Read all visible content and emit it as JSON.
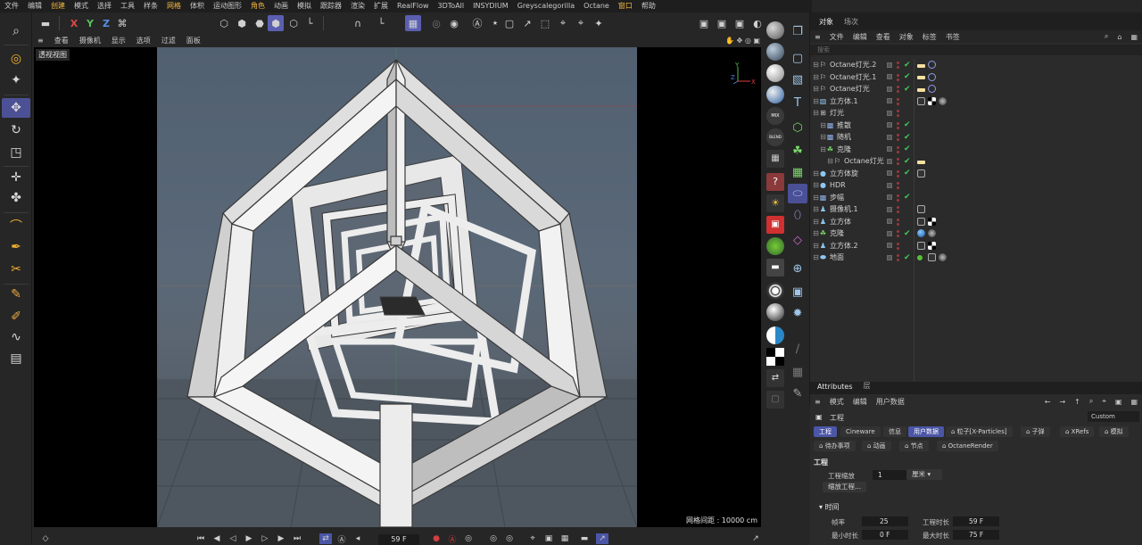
{
  "menubar": {
    "items": [
      {
        "label": "文件"
      },
      {
        "label": "编辑"
      },
      {
        "label": "创建",
        "highlight": true
      },
      {
        "label": "模式"
      },
      {
        "label": "选择"
      },
      {
        "label": "工具"
      },
      {
        "label": "样条"
      },
      {
        "label": "网格",
        "highlight": true
      },
      {
        "label": "体积"
      },
      {
        "label": "运动图形"
      },
      {
        "label": "角色",
        "highlight": true
      },
      {
        "label": "动画"
      },
      {
        "label": "模拟"
      },
      {
        "label": "跟踪器"
      },
      {
        "label": "渲染"
      },
      {
        "label": "扩展"
      },
      {
        "label": "RealFlow"
      },
      {
        "label": "3DToAll"
      },
      {
        "label": "INSYDIUM"
      },
      {
        "label": "Greyscalegorilla"
      },
      {
        "label": "Octane"
      },
      {
        "label": "窗口",
        "highlight": true
      },
      {
        "label": "帮助"
      }
    ]
  },
  "toolbar": {
    "axis_x": "X",
    "axis_y": "Y",
    "axis_z": "Z"
  },
  "viewmenu": {
    "items": [
      "查看",
      "摄像机",
      "显示",
      "选项",
      "过滤",
      "面板"
    ]
  },
  "viewport": {
    "label": "透视视图",
    "grid_spacing": "网格间距 : 10000 cm",
    "axis_x": "X",
    "axis_y": "Y",
    "axis_z": "Z"
  },
  "timeline": {
    "frame": "59 F"
  },
  "objects": {
    "tabs": [
      "对象",
      "场次"
    ],
    "menu": [
      "文件",
      "编辑",
      "查看",
      "对象",
      "标签",
      "书签"
    ],
    "search_placeholder": "搜索",
    "rows": [
      {
        "name": "Octane灯光.2",
        "indent": 0,
        "icon": "light-icon",
        "check": true,
        "tags": [
          "light-tag",
          "target-tag"
        ]
      },
      {
        "name": "Octane灯光.1",
        "indent": 0,
        "icon": "light-icon",
        "check": true,
        "tags": [
          "light-tag",
          "target-tag"
        ]
      },
      {
        "name": "Octane灯光",
        "indent": 0,
        "icon": "light-icon",
        "check": true,
        "tags": [
          "light-tag",
          "target-tag"
        ]
      },
      {
        "name": "立方体.1",
        "indent": 0,
        "icon": "cube-icon",
        "check": false,
        "tags": [
          "phong-tag",
          "texture-tag",
          "material-tag"
        ]
      },
      {
        "name": "灯光",
        "indent": 0,
        "icon": "null-icon",
        "check": false,
        "tags": []
      },
      {
        "name": "推散",
        "indent": 1,
        "icon": "effector-icon",
        "check": true,
        "tags": []
      },
      {
        "name": "随机",
        "indent": 1,
        "icon": "effector-icon",
        "check": true,
        "tags": []
      },
      {
        "name": "克隆",
        "indent": 1,
        "icon": "cloner-icon",
        "check": true,
        "tags": []
      },
      {
        "name": "Octane灯光",
        "indent": 2,
        "icon": "light-icon",
        "check": true,
        "tags": [
          "light-tag"
        ]
      },
      {
        "name": "立方体旋",
        "indent": 0,
        "icon": "sphere-icon",
        "check": true,
        "tags": [
          "phong-tag"
        ]
      },
      {
        "name": "HDR",
        "indent": 0,
        "icon": "sphere-icon",
        "check": false,
        "tags": []
      },
      {
        "name": "步幅",
        "indent": 0,
        "icon": "effector-icon",
        "check": true,
        "tags": []
      },
      {
        "name": "摄像机.1",
        "indent": 0,
        "icon": "camera-icon",
        "check": false,
        "tags": [
          "phong-tag"
        ]
      },
      {
        "name": "立方体",
        "indent": 0,
        "icon": "camera-icon",
        "check": false,
        "tags": [
          "phong-tag",
          "texture-tag"
        ]
      },
      {
        "name": "克隆",
        "indent": 0,
        "icon": "cloner-icon",
        "check": true,
        "tags": [
          "blue-sphere-tag",
          "material-tag"
        ]
      },
      {
        "name": "立方体.2",
        "indent": 0,
        "icon": "camera-icon",
        "check": false,
        "tags": [
          "phong-tag",
          "texture-tag"
        ]
      },
      {
        "name": "地面",
        "indent": 0,
        "icon": "floor-icon",
        "check": true,
        "tags": [
          "green-dot-tag",
          "phong-tag",
          "material-tag"
        ]
      }
    ]
  },
  "attributes": {
    "tabs": [
      "Attributes",
      "层"
    ],
    "menu": [
      "模式",
      "编辑",
      "用户数据"
    ],
    "title": "工程",
    "mode": "Custom",
    "tabs_row1": [
      {
        "label": "工程",
        "active": true
      },
      {
        "label": "Cineware"
      },
      {
        "label": "信息"
      },
      {
        "label": "用户数据",
        "active": true
      },
      {
        "label": "粒子[X-Particles]"
      },
      {
        "label": "子弹"
      },
      {
        "label": "XRefs"
      },
      {
        "label": "模拟"
      }
    ],
    "tabs_row2": [
      {
        "label": "待办事项"
      },
      {
        "label": "动画"
      },
      {
        "label": "节点"
      },
      {
        "label": "OctaneRender"
      }
    ],
    "section": "工程",
    "scale_label": "工程缩放",
    "scale_value": "1",
    "scale_unit": "厘米",
    "scale_button": "缩放工程...",
    "time_section": "时间",
    "fps_label": "帧率",
    "fps_value": "25",
    "duration_label": "工程时长",
    "duration_value": "59 F",
    "min_label": "最小时长",
    "min_value": "0 F",
    "max_label": "最大时长",
    "max_value": "75 F"
  },
  "colors": {
    "accent": "#4b56a6",
    "highlight_menu": "#f2b640",
    "ok_green": "#3fc95a"
  }
}
